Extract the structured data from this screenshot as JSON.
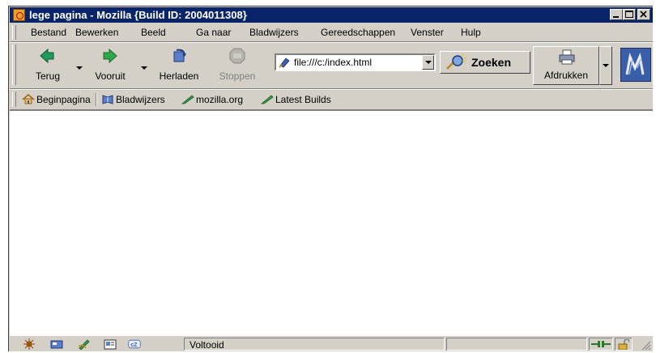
{
  "window": {
    "title": "lege pagina - Mozilla {Build ID: 2004011308}"
  },
  "menubar": {
    "items": [
      "Bestand",
      "Bewerken",
      "Beeld",
      "Ga naar",
      "Bladwijzers",
      "Gereedschappen",
      "Venster",
      "Hulp"
    ]
  },
  "navbar": {
    "back_label": "Terug",
    "forward_label": "Vooruit",
    "reload_label": "Herladen",
    "stop_label": "Stoppen",
    "url_value": "file:///c:/index.html",
    "search_label": "Zoeken",
    "print_label": "Afdrukken"
  },
  "personal_toolbar": {
    "items": [
      "Beginpagina",
      "Bladwijzers",
      "mozilla.org",
      "Latest Builds"
    ]
  },
  "statusbar": {
    "status_text": "Voltooid"
  },
  "colors": {
    "titlebar": "#0a246a",
    "chrome": "#d4d0c8",
    "back_arrow": "#1f9a5a",
    "forward_arrow": "#2fa84a",
    "disabled_text": "#808080"
  }
}
